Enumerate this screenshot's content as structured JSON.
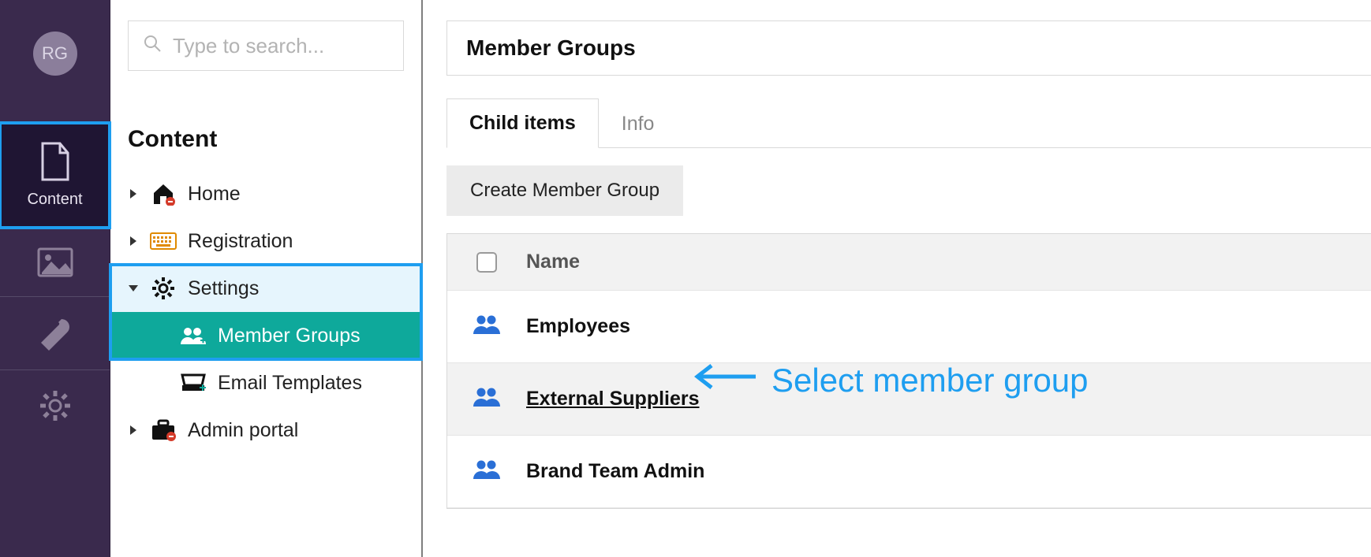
{
  "avatar_initials": "RG",
  "search": {
    "placeholder": "Type to search..."
  },
  "nav": {
    "content_label": "Content"
  },
  "tree": {
    "title": "Content",
    "home": "Home",
    "registration": "Registration",
    "settings": "Settings",
    "member_groups": "Member Groups",
    "email_templates": "Email Templates",
    "admin_portal": "Admin portal"
  },
  "page": {
    "title": "Member Groups",
    "tabs": {
      "child_items": "Child items",
      "info": "Info"
    },
    "create_label": "Create Member Group",
    "name_header": "Name",
    "rows": {
      "r0": "Employees",
      "r1": "External Suppliers",
      "r2": "Brand Team Admin"
    }
  },
  "annotation": "Select member group"
}
